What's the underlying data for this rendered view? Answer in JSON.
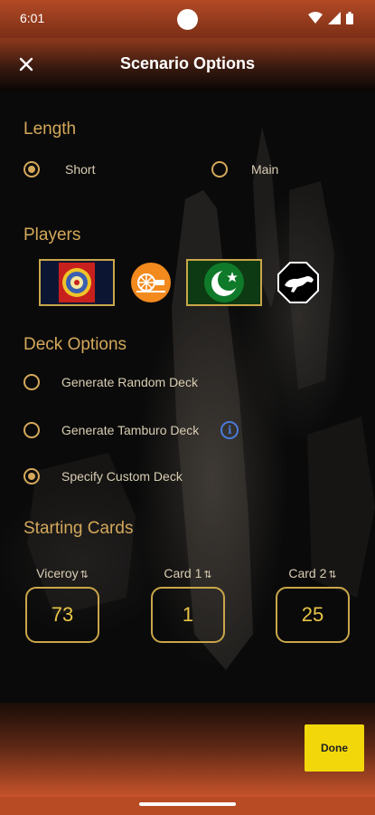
{
  "status_bar": {
    "time": "6:01"
  },
  "app_bar": {
    "title": "Scenario Options"
  },
  "length": {
    "title": "Length",
    "options": [
      {
        "label": "Short",
        "selected": true
      },
      {
        "label": "Main",
        "selected": false
      }
    ]
  },
  "players": {
    "title": "Players",
    "items": [
      {
        "icon": "star-of-india-flag-icon",
        "selected": true
      },
      {
        "icon": "charkha-spinning-wheel-icon",
        "selected": false
      },
      {
        "icon": "crescent-star-flag-icon",
        "selected": true
      },
      {
        "icon": "tiger-icon",
        "selected": false
      }
    ]
  },
  "deck_options": {
    "title": "Deck Options",
    "options": [
      {
        "label": "Generate Random Deck",
        "selected": false
      },
      {
        "label": "Generate Tamburo Deck",
        "selected": false,
        "info_icon": true
      },
      {
        "label": "Specify Custom Deck",
        "selected": true
      }
    ]
  },
  "starting_cards": {
    "title": "Starting Cards",
    "columns": [
      {
        "label": "Viceroy",
        "value": "73"
      },
      {
        "label": "Card 1",
        "value": "1"
      },
      {
        "label": "Card 2",
        "value": "25"
      }
    ]
  },
  "footer": {
    "done_label": "Done"
  },
  "colors": {
    "accent_gold": "#d4a85a",
    "value_yellow": "#e8c547",
    "done_button": "#f2d80a",
    "charkha_orange": "#f28a1e",
    "info_blue": "#4a7ad6"
  }
}
